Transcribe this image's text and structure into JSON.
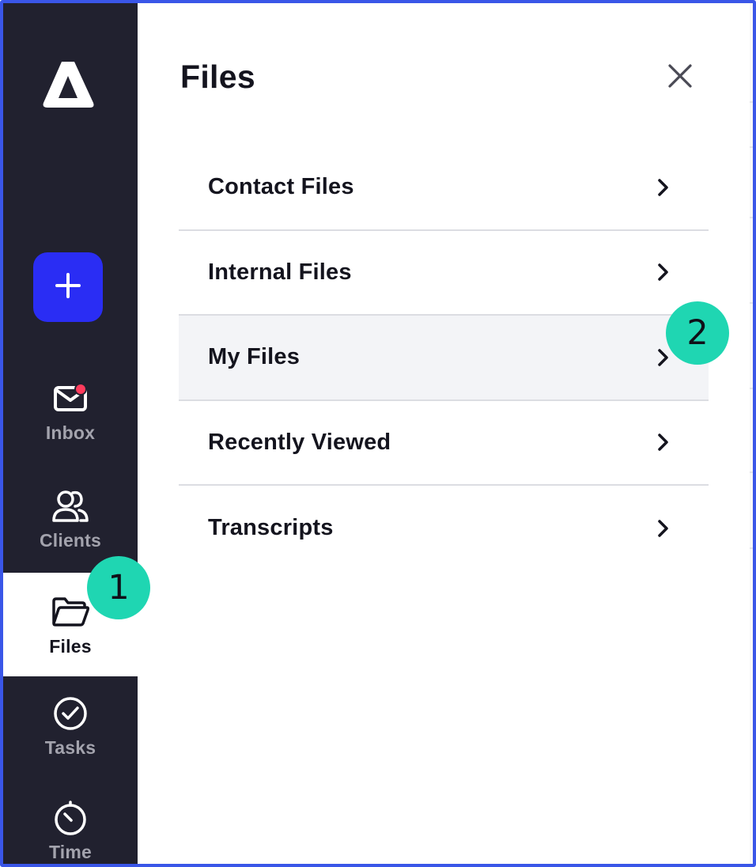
{
  "sidebar": {
    "new_button_icon": "plus-icon",
    "items": [
      {
        "label": "Inbox",
        "icon": "mail-icon",
        "has_notification": true
      },
      {
        "label": "Clients",
        "icon": "users-icon"
      },
      {
        "label": "Files",
        "icon": "folder-open-icon",
        "active": true
      },
      {
        "label": "Tasks",
        "icon": "check-circle-icon"
      },
      {
        "label": "Time",
        "icon": "timer-icon"
      }
    ]
  },
  "panel": {
    "title": "Files",
    "close_icon": "close-icon",
    "items": [
      {
        "label": "Contact Files"
      },
      {
        "label": "Internal Files"
      },
      {
        "label": "My Files",
        "highlighted": true
      },
      {
        "label": "Recently Viewed"
      },
      {
        "label": "Transcripts"
      }
    ]
  },
  "badges": {
    "step1": "1",
    "step2": "2"
  },
  "colors": {
    "sidebar_bg": "#21212f",
    "accent": "#2a2df4",
    "badge": "#1fd6b2",
    "notification": "#ff3b5c",
    "frame_border": "#3a56e8"
  }
}
